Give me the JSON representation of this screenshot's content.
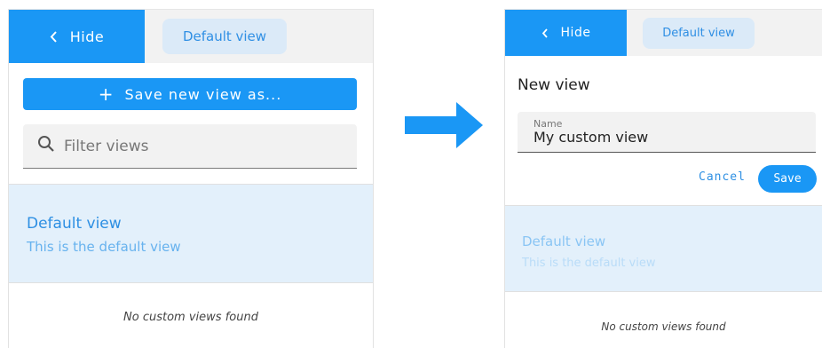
{
  "before": {
    "hide_label": "Hide",
    "view_chip": "Default view",
    "save_new_label": "Save new view as...",
    "filter_placeholder": "Filter views",
    "views": [
      {
        "title": "Default view",
        "subtitle": "This is the default view"
      }
    ],
    "empty_message": "No custom views found"
  },
  "after": {
    "hide_label": "Hide",
    "view_chip": "Default view",
    "form_title": "New view",
    "name_label": "Name",
    "name_value": "My custom view",
    "cancel_label": "Cancel",
    "save_label": "Save",
    "views": [
      {
        "title": "Default view",
        "subtitle": "This is the default view"
      }
    ],
    "empty_message": "No custom views found"
  },
  "icons": {
    "hide": "chevron-left-icon",
    "add": "plus-icon",
    "filter": "search-icon",
    "transition": "arrow-right-icon"
  },
  "colors": {
    "primary": "#1a97f5",
    "chip_bg": "#dbeaf8",
    "selected_bg": "#e3f0fb",
    "topbar_bg": "#f2f2f2"
  }
}
